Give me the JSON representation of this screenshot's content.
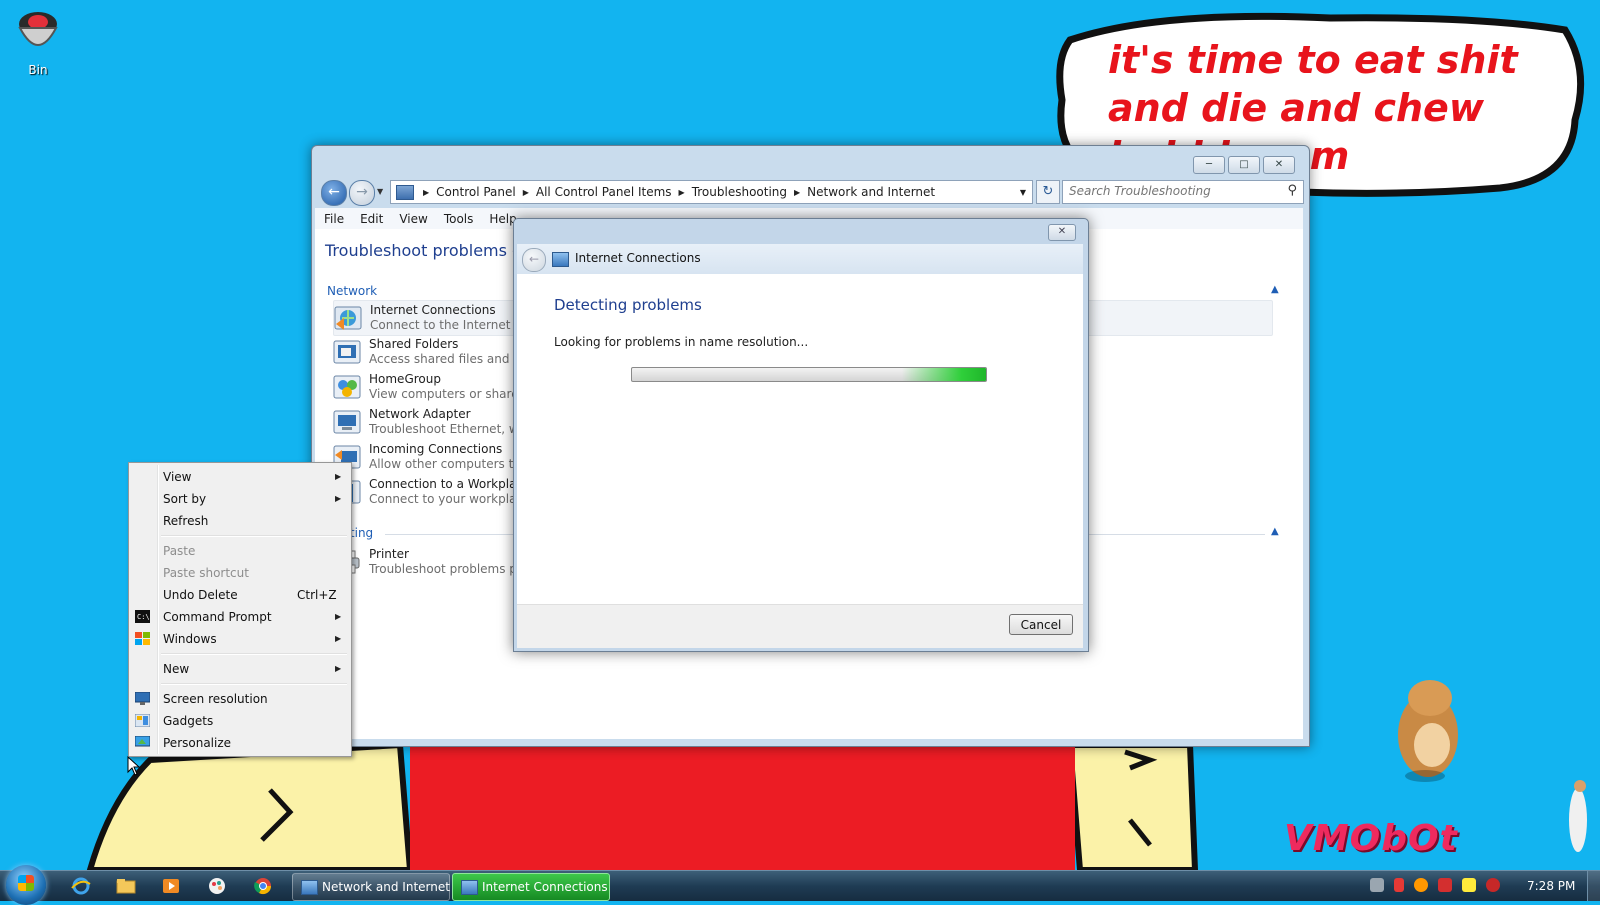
{
  "desktop": {
    "recycle_bin_label": "Bin",
    "speech_bubble_text": "it's time to eat shit\nand die and chew\nbubblegum",
    "watermark_text": "VMObOt"
  },
  "explorer": {
    "breadcrumbs": [
      "Control Panel",
      "All Control Panel Items",
      "Troubleshooting",
      "Network and Internet"
    ],
    "search_placeholder": "Search Troubleshooting",
    "menu": [
      "File",
      "Edit",
      "View",
      "Tools",
      "Help"
    ],
    "page_title": "Troubleshoot problems - Network and Internet",
    "groups": {
      "network": "Network",
      "printing": "Printing"
    },
    "items": [
      {
        "title": "Internet Connections",
        "desc": "Connect to the Internet or to a particular website."
      },
      {
        "title": "Shared Folders",
        "desc": "Access shared files and folders on other computers."
      },
      {
        "title": "HomeGroup",
        "desc": "View computers or shared files in a homegroup."
      },
      {
        "title": "Network Adapter",
        "desc": "Troubleshoot Ethernet, wireless, or other network adapters."
      },
      {
        "title": "Incoming Connections",
        "desc": "Allow other computers to connect to your computer."
      },
      {
        "title": "Connection to a Workplace Using DirectAccess",
        "desc": "Connect to your workplace network using DirectAccess."
      },
      {
        "title": "Printer",
        "desc": "Troubleshoot problems preventing printing from completing."
      }
    ]
  },
  "dialog": {
    "title": "Internet Connections",
    "heading": "Detecting problems",
    "message": "Looking for problems in name resolution...",
    "cancel_label": "Cancel"
  },
  "context_menu": {
    "items": [
      {
        "label": "View",
        "submenu": true
      },
      {
        "label": "Sort by",
        "submenu": true
      },
      {
        "label": "Refresh"
      },
      {
        "label": "Paste",
        "disabled": true
      },
      {
        "label": "Paste shortcut",
        "disabled": true
      },
      {
        "label": "Undo Delete",
        "shortcut": "Ctrl+Z"
      },
      {
        "label": "Command Prompt",
        "submenu": true,
        "icon": "cmd-icon"
      },
      {
        "label": "Windows",
        "submenu": true,
        "icon": "windows-flag-icon"
      },
      {
        "label": "New",
        "submenu": true
      },
      {
        "label": "Screen resolution",
        "icon": "monitor-icon"
      },
      {
        "label": "Gadgets",
        "icon": "gadgets-icon"
      },
      {
        "label": "Personalize",
        "icon": "personalize-icon"
      }
    ]
  },
  "taskbar": {
    "pinned": [
      "internet-explorer-icon",
      "file-explorer-icon",
      "media-player-icon",
      "paint-icon",
      "chrome-icon"
    ],
    "buttons": [
      {
        "label": "Network and Internet",
        "active": false
      },
      {
        "label": "Internet Connections",
        "active": true
      }
    ],
    "clock": "7:28 PM"
  },
  "colors": {
    "desktop_bg": "#12b4f0",
    "bubble_text": "#e8141c",
    "link_blue": "#1f5eb5",
    "progress_green": "#2fcf3a"
  }
}
